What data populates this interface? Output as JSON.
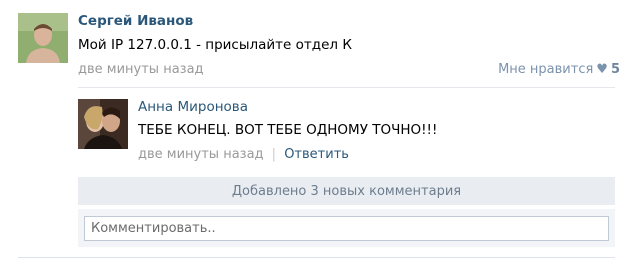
{
  "post": {
    "author": "Сергей Иванов",
    "text": "Мой IP 127.0.0.1 - присылайте отдел К",
    "time": "две минуты назад",
    "like_label": "Мне нравится",
    "like_count": "5"
  },
  "comment": {
    "author": "Анна Миронова",
    "text": "ТЕБЕ КОНЕЦ. ВОТ ТЕБЕ ОДНОМУ ТОЧНО!!!",
    "time": "две минуты назад",
    "separator": "|",
    "reply_label": "Ответить"
  },
  "new_comments_label": "Добавлено 3 новых комментария",
  "reply_box": {
    "placeholder": "Комментировать.."
  },
  "colors": {
    "link": "#2b587a",
    "muted": "#999999",
    "panel": "#e9edf1"
  },
  "icons": {
    "like": "heart-icon"
  }
}
